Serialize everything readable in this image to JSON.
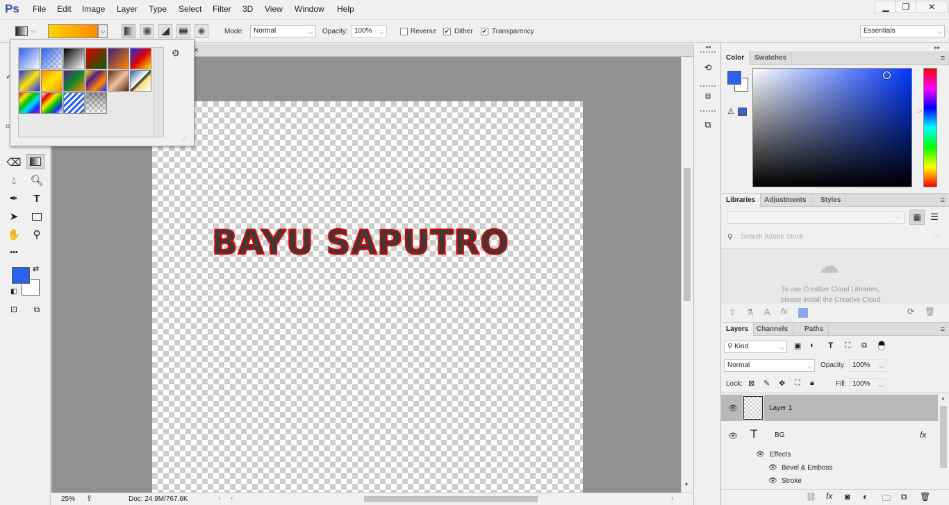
{
  "app": {
    "logo": "Ps"
  },
  "menu": {
    "items": [
      "File",
      "Edit",
      "Image",
      "Layer",
      "Type",
      "Select",
      "Filter",
      "3D",
      "View",
      "Window",
      "Help"
    ]
  },
  "window_controls": {
    "minimize": "▁",
    "restore": "❐",
    "close": "✕"
  },
  "options": {
    "mode_label": "Mode:",
    "mode_value": "Normal",
    "opacity_label": "Opacity:",
    "opacity_value": "100%",
    "reverse_label": "Reverse",
    "reverse_checked": false,
    "dither_label": "Dither",
    "dither_checked": true,
    "transparency_label": "Transparency",
    "transparency_checked": true,
    "workspace": "Essentials",
    "gradient_colors": [
      "#ffd400",
      "#ff8a00"
    ]
  },
  "document": {
    "canvas_text": "BAYU SAPUTRO",
    "text_fill": "#3a3a3a",
    "text_stroke": "#e00000",
    "zoom": "25%",
    "doc_info": "Doc: 24.9M/767.6K",
    "tab_close": "×"
  },
  "tools": {
    "foreground": "#2a62f0",
    "background": "#ffffff",
    "more": "•••"
  },
  "gradient_picker": {
    "presets": [
      "foreground-to-background",
      "foreground-to-transparent",
      "black-white",
      "red-green",
      "violet-orange",
      "blue-red-yellow",
      "blue-yellow-blue",
      "orange-yellow-orange",
      "violet-green-orange",
      "yellow-violet-orange-blue",
      "copper",
      "chrome",
      "spectrum",
      "transparent-rainbow",
      "transparent-stripes",
      "neutral-density"
    ]
  },
  "color_panel": {
    "tabs": [
      "Color",
      "Swatches"
    ],
    "hue_color": "#0038ff"
  },
  "libraries_panel": {
    "tabs": [
      "Libraries",
      "Adjustments",
      "Styles"
    ],
    "search_placeholder": "Search Adobe Stock",
    "message_line1": "To use Creative Cloud Libraries,",
    "message_line2": "please install the Creative Cloud",
    "swatch_color": "#8aa6e8"
  },
  "layers_panel": {
    "tabs": [
      "Layers",
      "Channels",
      "Paths"
    ],
    "filter_kind": "Kind",
    "blend_mode": "Normal",
    "opacity_label": "Opacity:",
    "opacity_value": "100%",
    "lock_label": "Lock:",
    "fill_label": "Fill:",
    "fill_value": "100%",
    "layers": [
      {
        "name": "Layer 1",
        "selected": true
      },
      {
        "name": "BG",
        "type": "text",
        "fx": "fx"
      }
    ],
    "effects_label": "Effects",
    "effects": [
      "Bevel & Emboss",
      "Stroke"
    ]
  }
}
